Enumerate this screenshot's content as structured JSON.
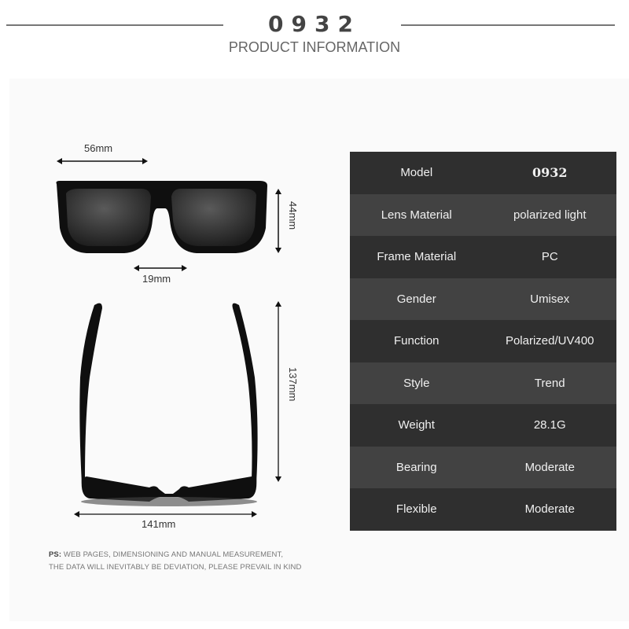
{
  "header": {
    "model_number": "0932",
    "subtitle": "PRODUCT INFORMATION"
  },
  "dimensions": {
    "lens_width": "56mm",
    "lens_height": "44mm",
    "bridge_width": "19mm",
    "temple_length": "137mm",
    "frame_width": "141mm"
  },
  "specs": [
    {
      "label": "Model",
      "value": "0932"
    },
    {
      "label": "Lens Material",
      "value": "polarized light"
    },
    {
      "label": "Frame Material",
      "value": "PC"
    },
    {
      "label": "Gender",
      "value": "Umisex"
    },
    {
      "label": "Function",
      "value": "Polarized/UV400"
    },
    {
      "label": "Style",
      "value": "Trend"
    },
    {
      "label": "Weight",
      "value": "28.1G"
    },
    {
      "label": "Bearing",
      "value": "Moderate"
    },
    {
      "label": "Flexible",
      "value": "Moderate"
    }
  ],
  "note": {
    "prefix": "PS:",
    "line1": "WEB PAGES, DIMENSIONING AND MANUAL MEASUREMENT,",
    "line2": "THE DATA WILL INEVITABLY BE DEVIATION, PLEASE PREVAIL IN KIND"
  },
  "colors": {
    "row_dark": "#2f2f2f",
    "row_light": "#424242",
    "panel_bg": "#fafafa"
  }
}
